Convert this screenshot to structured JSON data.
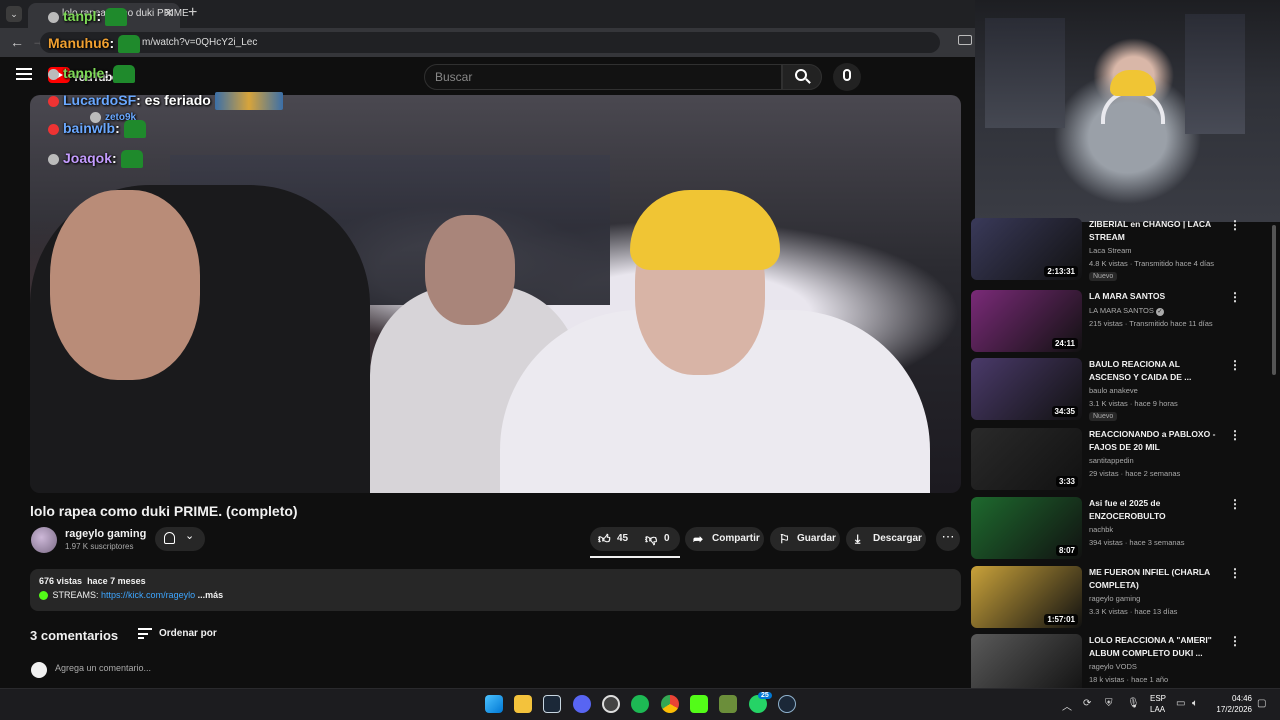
{
  "browser": {
    "tab_title": "lolo rapea como duki PRIME",
    "url": "m/watch?v=0QHcY2i_Lec"
  },
  "header": {
    "logo_text": "YouTube",
    "search_placeholder": "Buscar"
  },
  "chat": [
    {
      "user": "tanpl",
      "message": ":",
      "color": "#7ed957"
    },
    {
      "user": "Manuhu6",
      "message": ":",
      "color": "#f0a030"
    },
    {
      "user": "tanple",
      "message": ":",
      "color": "#7ed957"
    },
    {
      "user": "LucardoSF",
      "message": ": es feriado",
      "color": "#6aa8ff"
    },
    {
      "user": "zeto9k",
      "message": "",
      "color": "#6aa8ff"
    },
    {
      "user": "bainwlb",
      "message": ":",
      "color": "#6aa8ff"
    },
    {
      "user": "Joaqok",
      "message": ":",
      "color": "#c49cff"
    }
  ],
  "video": {
    "title": "lolo rapea como duki PRIME. (completo)",
    "channel": "rageylo gaming",
    "subscribers": "1.97 K suscriptores",
    "likes": "45",
    "dislikes": "0",
    "share_label": "Compartir",
    "save_label": "Guardar",
    "download_label": "Descargar"
  },
  "description": {
    "views": "676 vistas",
    "date": "hace 7 meses",
    "streams_label": "STREAMS:",
    "link": "https://kick.com/rageylo",
    "more": "...más"
  },
  "comments": {
    "count_label": "3 comentarios",
    "sort_label": "Ordenar por",
    "placeholder": "Agrega un comentario..."
  },
  "recommendations": [
    {
      "title": "ZIBERIAL en CHANGO | LACA STREAM",
      "channel": "Laca Stream",
      "meta": "4.8 K vistas · Transmitido hace 4 días",
      "badge": "Nuevo",
      "duration": "2:13:31",
      "thumb": "#3a3a5a"
    },
    {
      "title": "LA MARA SANTOS",
      "channel": "LA MARA SANTOS",
      "verified": true,
      "meta": "215 vistas · Transmitido hace 11 días",
      "badge": "",
      "duration": "24:11",
      "thumb": "#7a2a78"
    },
    {
      "title": "BAULO REACIONA AL ASCENSO Y CAIDA DE ...",
      "channel": "baulo anakeve",
      "meta": "3.1 K vistas · hace 9 horas",
      "badge": "Nuevo",
      "duration": "34:35",
      "thumb": "#4a3a6a"
    },
    {
      "title": "REACCIONANDO a PABLOXO - FAJOS DE 20 MIL",
      "channel": "santitappedin",
      "meta": "29 vistas · hace 2 semanas",
      "badge": "",
      "duration": "3:33",
      "thumb": "#2a2a2a"
    },
    {
      "title": "Asi fue el 2025 de ENZOCEROBULTO",
      "channel": "nachbk",
      "meta": "394 vistas · hace 3 semanas",
      "badge": "",
      "duration": "8:07",
      "thumb": "#1e6a2e"
    },
    {
      "title": "ME FUERON INFIEL (CHARLA COMPLETA)",
      "channel": "rageylo gaming",
      "meta": "3.3 K vistas · hace 13 días",
      "badge": "",
      "duration": "1:57:01",
      "thumb": "#c9a23a"
    },
    {
      "title": "LOLO REACCIONA A \"AMERI\" ALBUM COMPLETO DUKI ...",
      "channel": "rageylo VODS",
      "meta": "18 k vistas · hace 1 año",
      "badge": "",
      "duration": "",
      "thumb": "#5a5a5a"
    }
  ],
  "taskbar": {
    "whatsapp_badge": "25",
    "lang_line1": "ESP",
    "lang_line2": "LAA",
    "time": "04:46",
    "date": "17/2/2026"
  }
}
